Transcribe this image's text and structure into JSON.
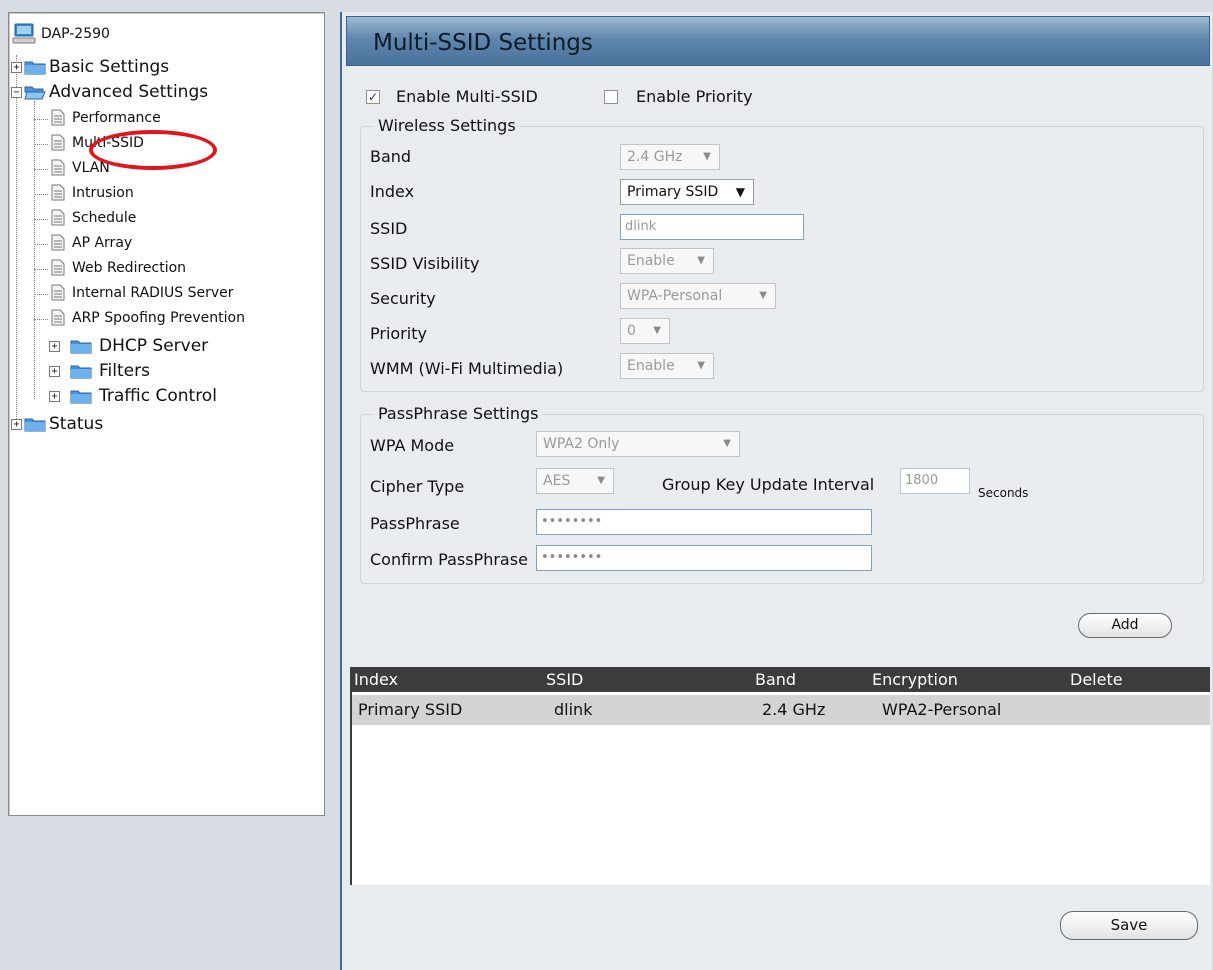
{
  "tree": {
    "root_label": "DAP-2590",
    "basic_settings": "Basic Settings",
    "advanced_settings": "Advanced Settings",
    "sub_items": [
      "Performance",
      "Multi-SSID",
      "VLAN",
      "Intrusion",
      "Schedule",
      "AP Array",
      "Web Redirection",
      "Internal RADIUS Server",
      "ARP Spoofing Prevention"
    ],
    "dhcp_server": "DHCP Server",
    "filters": "Filters",
    "traffic_control": "Traffic Control",
    "status": "Status",
    "expand_symbol": "+",
    "collapse_symbol": "−"
  },
  "main": {
    "title": "Multi-SSID Settings",
    "enable_multi_ssid": {
      "label": "Enable Multi-SSID",
      "checked": true,
      "mark": "✓"
    },
    "enable_priority": {
      "label": "Enable Priority",
      "checked": false
    },
    "wireless": {
      "legend": "Wireless Settings",
      "band_label": "Band",
      "band_value": "2.4 GHz",
      "index_label": "Index",
      "index_value": "Primary SSID",
      "ssid_label": "SSID",
      "ssid_value": "dlink",
      "visibility_label": "SSID Visibility",
      "visibility_value": "Enable",
      "security_label": "Security",
      "security_value": "WPA-Personal",
      "priority_label": "Priority",
      "priority_value": "0",
      "wmm_label": "WMM (Wi-Fi Multimedia)",
      "wmm_value": "Enable"
    },
    "passphrase": {
      "legend": "PassPhrase Settings",
      "wpa_mode_label": "WPA Mode",
      "wpa_mode_value": "WPA2 Only",
      "cipher_label": "Cipher Type",
      "cipher_value": "AES",
      "group_key_label": "Group Key Update Interval",
      "group_key_value": "1800",
      "seconds_label": "Seconds",
      "passphrase_label": "PassPhrase",
      "passphrase_value": "••••••••",
      "confirm_label": "Confirm PassPhrase",
      "confirm_value": "••••••••"
    },
    "add_button": "Add",
    "save_button": "Save",
    "table": {
      "headers": [
        "Index",
        "SSID",
        "Band",
        "Encryption",
        "Delete"
      ],
      "rows": [
        {
          "index": "Primary SSID",
          "ssid": "dlink",
          "band": "2.4 GHz",
          "encryption": "WPA2-Personal"
        }
      ]
    }
  },
  "colors": {
    "header_blue": "#5f86ad",
    "highlight_red": "#e2141c",
    "table_header": "#3c3c3c",
    "selected_row": "#d3d3d3"
  }
}
